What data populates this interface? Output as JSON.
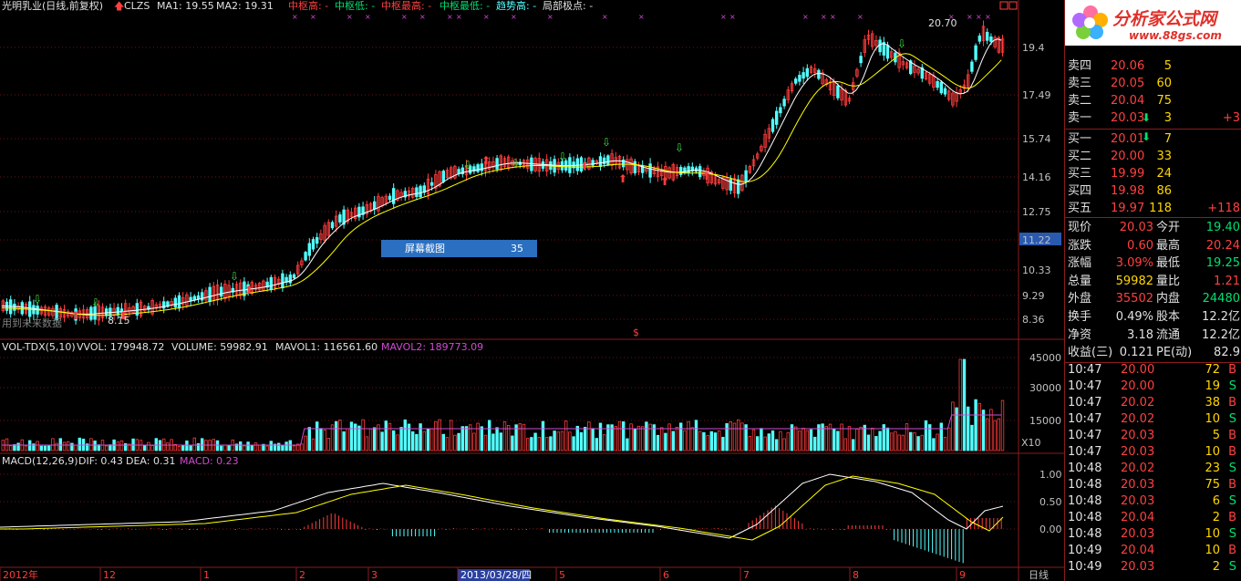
{
  "header": {
    "stock_name": "光明乳业(日线,前复权)",
    "indicator": "CLZS",
    "ma1": "MA1: 19.55",
    "ma2": "MA2: 19.31",
    "zhongshu_high": "中枢高: -",
    "zhongshu_low": "中枢低: -",
    "zhongshu_highest": "中枢最高: -",
    "zhongshu_lowest": "中枢最低: -",
    "trend_high": "趋势高: -",
    "local_extreme": "局部极点: -"
  },
  "price_axis": [
    "19.4",
    "17.49",
    "15.74",
    "14.16",
    "12.75",
    "11.22",
    "10.33",
    "9.29",
    "8.36"
  ],
  "price_labels": {
    "high_mark": "20.70",
    "low_mark": "8.15",
    "future_text": "用到未来数据"
  },
  "volume_header": {
    "name": "VOL-TDX(5,10)",
    "vvol": "VVOL: 179948.72",
    "volume": "VOLUME: 59982.91",
    "mavol1": "MAVOL1: 116561.60",
    "mavol2": "MAVOL2: 189773.09"
  },
  "volume_axis": [
    "45000",
    "30000",
    "15000"
  ],
  "volume_unit": "X10",
  "macd_header": {
    "name": "MACD(12,26,9)",
    "dif": "DIF: 0.43",
    "dea": "DEA: 0.31",
    "macd": "MACD: 0.23"
  },
  "macd_axis": [
    "1.00",
    "0.50",
    "0.00"
  ],
  "date_axis": [
    "2012年",
    "12",
    "1",
    "2",
    "3",
    "2013/03/28/四",
    "5",
    "6",
    "7",
    "8",
    "9"
  ],
  "period_label": "日线",
  "screenshot_tip": {
    "label": "屏幕截图",
    "count": "35"
  },
  "order_book": {
    "asks": [
      {
        "name": "卖四",
        "price": "20.06",
        "vol": "5",
        "chg": ""
      },
      {
        "name": "卖三",
        "price": "20.05",
        "vol": "60",
        "chg": ""
      },
      {
        "name": "卖二",
        "price": "20.04",
        "vol": "75",
        "chg": ""
      },
      {
        "name": "卖一",
        "price": "20.03",
        "vol": "3",
        "chg": "+3"
      }
    ],
    "bids": [
      {
        "name": "买一",
        "price": "20.01",
        "vol": "7",
        "chg": ""
      },
      {
        "name": "买二",
        "price": "20.00",
        "vol": "33",
        "chg": ""
      },
      {
        "name": "买三",
        "price": "19.99",
        "vol": "24",
        "chg": ""
      },
      {
        "name": "买四",
        "price": "19.98",
        "vol": "86",
        "chg": ""
      },
      {
        "name": "买五",
        "price": "19.97",
        "vol": "118",
        "chg": "+118"
      }
    ]
  },
  "quote": [
    {
      "l1": "现价",
      "v1": "20.03",
      "l2": "今开",
      "v2": "19.40",
      "c1": "red",
      "c2": "green"
    },
    {
      "l1": "涨跌",
      "v1": "0.60",
      "l2": "最高",
      "v2": "20.24",
      "c1": "red",
      "c2": "red"
    },
    {
      "l1": "涨幅",
      "v1": "3.09%",
      "l2": "最低",
      "v2": "19.25",
      "c1": "red",
      "c2": "green"
    },
    {
      "l1": "总量",
      "v1": "59982",
      "l2": "量比",
      "v2": "1.21",
      "c1": "yellow",
      "c2": "red"
    },
    {
      "l1": "外盘",
      "v1": "35502",
      "l2": "内盘",
      "v2": "24480",
      "c1": "red",
      "c2": "green"
    },
    {
      "l1": "换手",
      "v1": "0.49%",
      "l2": "股本",
      "v2": "12.2亿",
      "c1": "white",
      "c2": "white"
    },
    {
      "l1": "净资",
      "v1": "3.18",
      "l2": "流通",
      "v2": "12.2亿",
      "c1": "white",
      "c2": "white"
    },
    {
      "l1": "收益(三)",
      "v1": "0.121",
      "l2": "PE(动)",
      "v2": "82.9",
      "c1": "white",
      "c2": "white"
    }
  ],
  "ticks": [
    {
      "time": "10:47",
      "price": "20.00",
      "vol": "72",
      "side": "B"
    },
    {
      "time": "10:47",
      "price": "20.00",
      "vol": "19",
      "side": "S"
    },
    {
      "time": "10:47",
      "price": "20.02",
      "vol": "38",
      "side": "B"
    },
    {
      "time": "10:47",
      "price": "20.02",
      "vol": "10",
      "side": "S"
    },
    {
      "time": "10:47",
      "price": "20.03",
      "vol": "5",
      "side": "B"
    },
    {
      "time": "10:47",
      "price": "20.03",
      "vol": "10",
      "side": "B"
    },
    {
      "time": "10:48",
      "price": "20.02",
      "vol": "23",
      "side": "S"
    },
    {
      "time": "10:48",
      "price": "20.03",
      "vol": "75",
      "side": "B"
    },
    {
      "time": "10:48",
      "price": "20.03",
      "vol": "6",
      "side": "S"
    },
    {
      "time": "10:48",
      "price": "20.04",
      "vol": "2",
      "side": "B"
    },
    {
      "time": "10:48",
      "price": "20.03",
      "vol": "10",
      "side": "S"
    },
    {
      "time": "10:49",
      "price": "20.04",
      "vol": "10",
      "side": "B"
    },
    {
      "time": "10:49",
      "price": "20.03",
      "vol": "2",
      "side": "S"
    }
  ],
  "logo": {
    "text": "分析家公式网",
    "url_text": "www.88gs.com"
  },
  "colors": {
    "up": "#ff3c3c",
    "down": "#54ffff",
    "ma1": "#ffffff",
    "ma2": "#ffff00",
    "grid": "#8a1c1c",
    "text_red": "#ff4040",
    "text_green": "#00e070",
    "purple": "#d24bd2"
  }
}
